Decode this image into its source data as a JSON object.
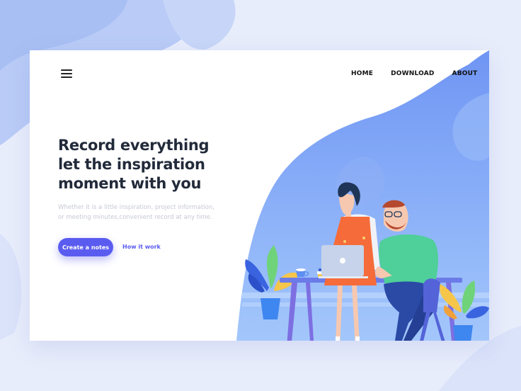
{
  "header": {
    "menu_icon": "hamburger-menu-icon",
    "nav": [
      {
        "label": "HOME"
      },
      {
        "label": "DOWNLOAD"
      },
      {
        "label": "ABOUT"
      }
    ]
  },
  "hero": {
    "headline_lines": [
      "Record everything",
      "let the inspiration",
      "moment with you"
    ],
    "sub_lines": [
      "Whether it is a little inspiration,  project information,",
      "or meeting minutes,convenient record at any time."
    ],
    "primary_button": "Create a notes",
    "secondary_link": "How it work"
  },
  "colors": {
    "accent": "#5a5cf0",
    "page_bg": "#e8edfb",
    "wave_blue": "#7ea6f6",
    "headline": "#222a3a"
  }
}
